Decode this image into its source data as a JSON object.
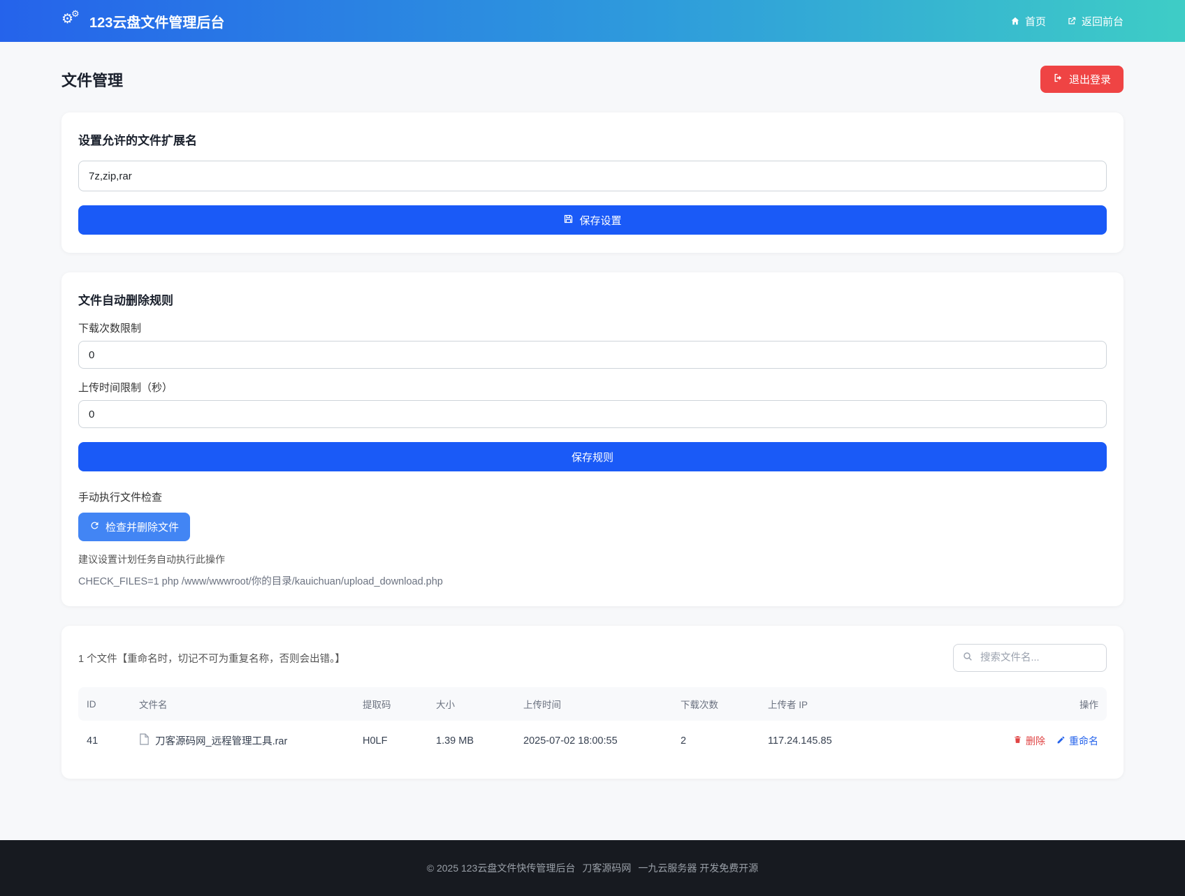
{
  "navbar": {
    "title": "123云盘文件管理后台",
    "home_label": "首页",
    "back_label": "返回前台"
  },
  "page": {
    "title": "文件管理",
    "logout_label": "退出登录"
  },
  "extensions_card": {
    "heading": "设置允许的文件扩展名",
    "input_value": "7z,zip,rar",
    "save_label": "保存设置"
  },
  "rules_card": {
    "heading": "文件自动删除规则",
    "download_limit_label": "下载次数限制",
    "download_limit_value": "0",
    "upload_time_label": "上传时间限制（秒）",
    "upload_time_value": "0",
    "save_label": "保存规则",
    "manual_check_label": "手动执行文件检查",
    "check_button_label": "检查并删除文件",
    "hint": "建议设置计划任务自动执行此操作",
    "command": "CHECK_FILES=1 php /www/wwwroot/你的目录/kauichuan/upload_download.php"
  },
  "files_card": {
    "summary": "1 个文件【重命名时，切记不可为重复名称，否则会出错。】",
    "search_placeholder": "搜索文件名...",
    "table": {
      "headers": [
        "ID",
        "文件名",
        "提取码",
        "大小",
        "上传时间",
        "下载次数",
        "上传者 IP",
        "操作"
      ],
      "rows": [
        {
          "id": "41",
          "name": "刀客源码网_远程管理工具.rar",
          "code": "H0LF",
          "size": "1.39 MB",
          "time": "2025-07-02 18:00:55",
          "downloads": "2",
          "ip": "117.24.145.85",
          "delete_label": "删除",
          "rename_label": "重命名"
        }
      ]
    }
  },
  "footer": {
    "copyright": "© 2025 123云盘文件快传管理后台",
    "link1": "刀客源码网",
    "link2": "一九云服务器 开发免费开源"
  },
  "icons": {
    "gear": "⚙"
  },
  "colors": {
    "navbar_gradient_start": "#2563eb",
    "navbar_gradient_end": "#3ecdc6",
    "primary_button": "#1a5af7",
    "check_button": "#4285f4",
    "logout_red": "#ef4444",
    "delete_red": "#e04444",
    "rename_blue": "#2563eb",
    "page_bg": "#f7f8fa",
    "footer_bg": "#171a20"
  }
}
